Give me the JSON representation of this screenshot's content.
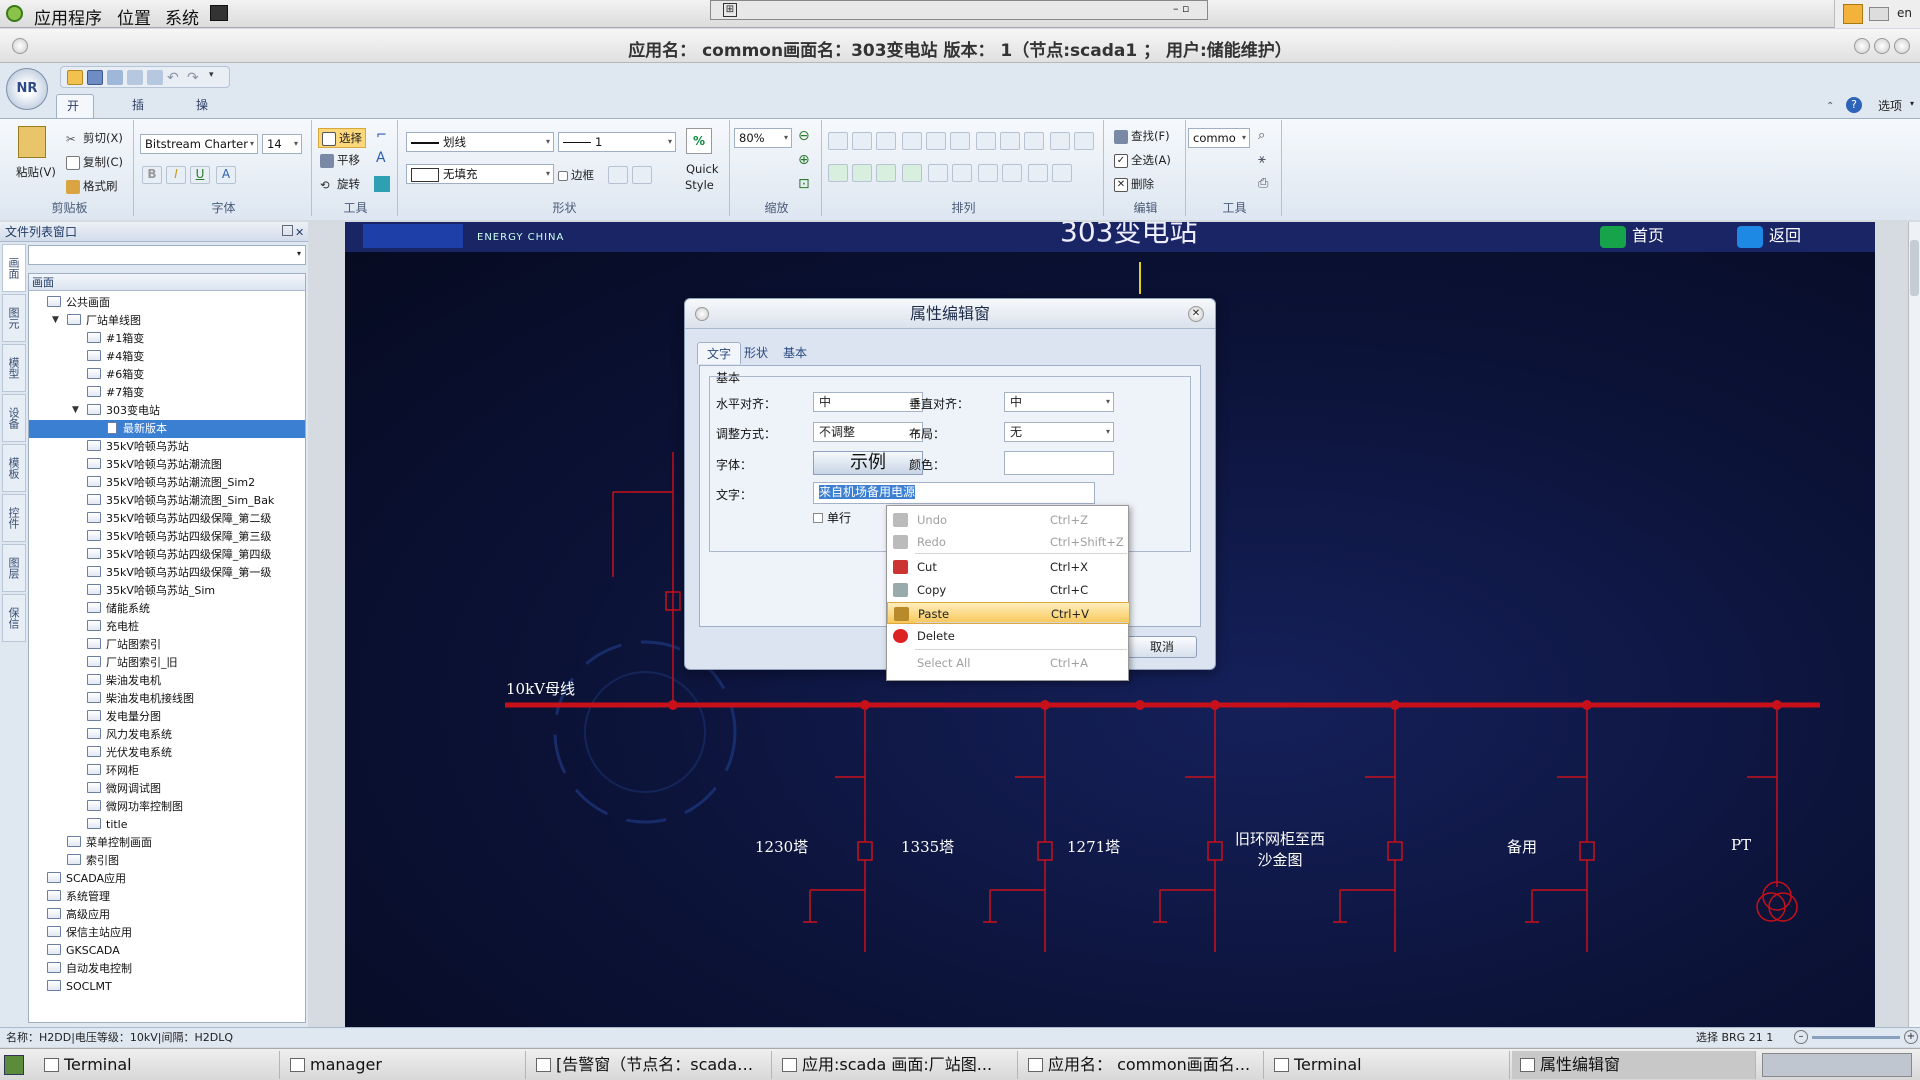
{
  "os_menu": {
    "apps": "应用程序",
    "places": "位置",
    "system": "系统"
  },
  "tray": {
    "lang": "en"
  },
  "window_title": "应用名： common画面名：303变电站 版本： 1（节点:scada1 ； 用户:储能维护）",
  "ribbon": {
    "tabs": [
      "开始(F)",
      "插入(I)",
      "操作(O)"
    ],
    "options_label": "选项",
    "clipboard": {
      "paste": "粘贴(V)",
      "cut": "剪切(X)",
      "copy": "复制(C)",
      "format_painter": "格式刷",
      "group": "剪贴板"
    },
    "font": {
      "family": "Bitstream Charter",
      "size": "14",
      "group": "字体"
    },
    "tools": {
      "select": "选择",
      "pan": "平移",
      "rotate": "旋转",
      "group": "工具"
    },
    "shape": {
      "line_style": "划线",
      "line_width": "1",
      "fill": "无填充",
      "border": "边框",
      "quick_style_1": "Quick",
      "quick_style_2": "Style",
      "group": "形状"
    },
    "zoom": {
      "value": "80%",
      "group": "缩放"
    },
    "arrange": {
      "group": "排列"
    },
    "edit": {
      "find": "查找(F)",
      "select_all": "全选(A)",
      "delete": "删除",
      "group": "编辑"
    },
    "tool2": {
      "combo": "commo",
      "group": "工具"
    }
  },
  "left_panel": {
    "title": "文件列表窗口",
    "vtabs": [
      "画面",
      "图元",
      "模型",
      "设备",
      "模板",
      "控件",
      "图层",
      "保信"
    ],
    "tree_header": "画面",
    "tree": [
      {
        "label": "公共画面",
        "level": 0,
        "type": "folder"
      },
      {
        "label": "厂站单线图",
        "level": 1,
        "type": "folder",
        "expanded": true
      },
      {
        "label": "#1箱变",
        "level": 2,
        "type": "folder"
      },
      {
        "label": "#4箱变",
        "level": 2,
        "type": "folder"
      },
      {
        "label": "#6箱变",
        "level": 2,
        "type": "folder"
      },
      {
        "label": "#7箱变",
        "level": 2,
        "type": "folder"
      },
      {
        "label": "303变电站",
        "level": 2,
        "type": "folder",
        "expanded": true
      },
      {
        "label": "最新版本",
        "level": 3,
        "type": "doc",
        "selected": true
      },
      {
        "label": "35kV哈顿乌苏站",
        "level": 2,
        "type": "folder"
      },
      {
        "label": "35kV哈顿乌苏站潮流图",
        "level": 2,
        "type": "folder"
      },
      {
        "label": "35kV哈顿乌苏站潮流图_Sim2",
        "level": 2,
        "type": "folder"
      },
      {
        "label": "35kV哈顿乌苏站潮流图_Sim_Bak",
        "level": 2,
        "type": "folder"
      },
      {
        "label": "35kV哈顿乌苏站四级保障_第二级",
        "level": 2,
        "type": "folder"
      },
      {
        "label": "35kV哈顿乌苏站四级保障_第三级",
        "level": 2,
        "type": "folder"
      },
      {
        "label": "35kV哈顿乌苏站四级保障_第四级",
        "level": 2,
        "type": "folder"
      },
      {
        "label": "35kV哈顿乌苏站四级保障_第一级",
        "level": 2,
        "type": "folder"
      },
      {
        "label": "35kV哈顿乌苏站_Sim",
        "level": 2,
        "type": "folder"
      },
      {
        "label": "储能系统",
        "level": 2,
        "type": "folder"
      },
      {
        "label": "充电桩",
        "level": 2,
        "type": "folder"
      },
      {
        "label": "厂站图索引",
        "level": 2,
        "type": "folder"
      },
      {
        "label": "厂站图索引_旧",
        "level": 2,
        "type": "folder"
      },
      {
        "label": "柴油发电机",
        "level": 2,
        "type": "folder"
      },
      {
        "label": "柴油发电机接线图",
        "level": 2,
        "type": "folder"
      },
      {
        "label": "发电量分图",
        "level": 2,
        "type": "folder"
      },
      {
        "label": "风力发电系统",
        "level": 2,
        "type": "folder"
      },
      {
        "label": "光伏发电系统",
        "level": 2,
        "type": "folder"
      },
      {
        "label": "环网柜",
        "level": 2,
        "type": "folder"
      },
      {
        "label": "微网调试图",
        "level": 2,
        "type": "folder"
      },
      {
        "label": "微网功率控制图",
        "level": 2,
        "type": "folder"
      },
      {
        "label": "title",
        "level": 2,
        "type": "folder"
      },
      {
        "label": "菜单控制画面",
        "level": 1,
        "type": "folder"
      },
      {
        "label": "索引图",
        "level": 1,
        "type": "folder"
      },
      {
        "label": "SCADA应用",
        "level": 0,
        "type": "folder"
      },
      {
        "label": "系统管理",
        "level": 0,
        "type": "folder"
      },
      {
        "label": "高级应用",
        "level": 0,
        "type": "folder"
      },
      {
        "label": "保信主站应用",
        "level": 0,
        "type": "folder"
      },
      {
        "label": "GKSCADA",
        "level": 0,
        "type": "folder"
      },
      {
        "label": "自动发电控制",
        "level": 0,
        "type": "folder"
      },
      {
        "label": "SOCLMT",
        "level": 0,
        "type": "folder"
      }
    ]
  },
  "canvas": {
    "banner_title": "303变电站",
    "logo_text": "ENERGY CHINA",
    "home_label": "首页",
    "back_label": "返回",
    "bus_label": "10kV母线",
    "feeders": [
      "1230塔",
      "1335塔",
      "1271塔",
      "旧环网柜至西\n沙金图",
      "备用",
      "PT"
    ],
    "bus_color": "#c8101a"
  },
  "dialog": {
    "title": "属性编辑窗",
    "tabs": [
      "文字",
      "形状",
      "基本"
    ],
    "group": "基本",
    "h_align_label": "水平对齐：",
    "h_align": "中",
    "v_align_label": "垂直对齐：",
    "v_align": "中",
    "adjust_label": "调整方式：",
    "adjust": "不调整",
    "layout_label": "布局：",
    "layout": "无",
    "font_label": "字体：",
    "sample": "示例",
    "color_label": "颜色：",
    "text_label": "文字：",
    "text_value": "来自机场备用电源",
    "single_line": "单行",
    "cancel": "取消"
  },
  "context_menu": [
    {
      "label": "Undo",
      "shortcut": "Ctrl+Z",
      "disabled": true,
      "icon": "undo-icon"
    },
    {
      "label": "Redo",
      "shortcut": "Ctrl+Shift+Z",
      "disabled": true,
      "icon": "redo-icon"
    },
    {
      "label": "Cut",
      "shortcut": "Ctrl+X",
      "disabled": false,
      "icon": "scissors-icon"
    },
    {
      "label": "Copy",
      "shortcut": "Ctrl+C",
      "disabled": false,
      "icon": "copy-icon"
    },
    {
      "label": "Paste",
      "shortcut": "Ctrl+V",
      "disabled": false,
      "highlighted": true,
      "icon": "paste-icon"
    },
    {
      "label": "Delete",
      "shortcut": "",
      "disabled": false,
      "icon": "delete-icon"
    },
    {
      "label": "Select All",
      "shortcut": "Ctrl+A",
      "disabled": true,
      "icon": ""
    }
  ],
  "status": {
    "left": "名称：H2DD|电压等级：10kV|间隔：H2DLQ",
    "right": "选择  BRG  21  1"
  },
  "taskbar": [
    {
      "label": "Terminal"
    },
    {
      "label": "manager"
    },
    {
      "label": "[告警窗（节点名：scada…"
    },
    {
      "label": "应用:scada 画面:厂站图..."
    },
    {
      "label": "应用名： common画面名..."
    },
    {
      "label": "Terminal"
    },
    {
      "label": "属性编辑窗",
      "active": true
    }
  ]
}
